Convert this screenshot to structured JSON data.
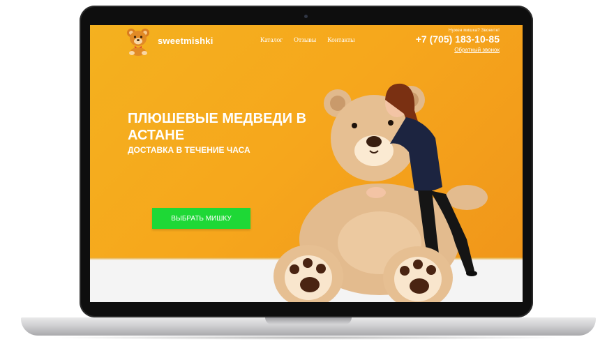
{
  "site": {
    "brand": "sweetmishki",
    "logo_icon": "teddy-bear-logo-icon",
    "accent_color": "#f4a91d",
    "cta_color": "#1ed836"
  },
  "nav": {
    "items": [
      {
        "label": "Каталог"
      },
      {
        "label": "Отзывы"
      },
      {
        "label": "Контакты"
      }
    ]
  },
  "contact": {
    "note": "Нужен мишка? Звоните!",
    "phone": "+7 (705) 183-10-85",
    "callback_label": "Обратный звонок"
  },
  "hero": {
    "title": "ПЛЮШЕВЫЕ МЕДВЕДИ В АСТАНЕ",
    "subtitle": "ДОСТАВКА В ТЕЧЕНИЕ ЧАСА",
    "cta_label": "ВЫБРАТЬ МИШКУ",
    "image_icon": "giant-teddy-bear-with-girl-illustration"
  }
}
